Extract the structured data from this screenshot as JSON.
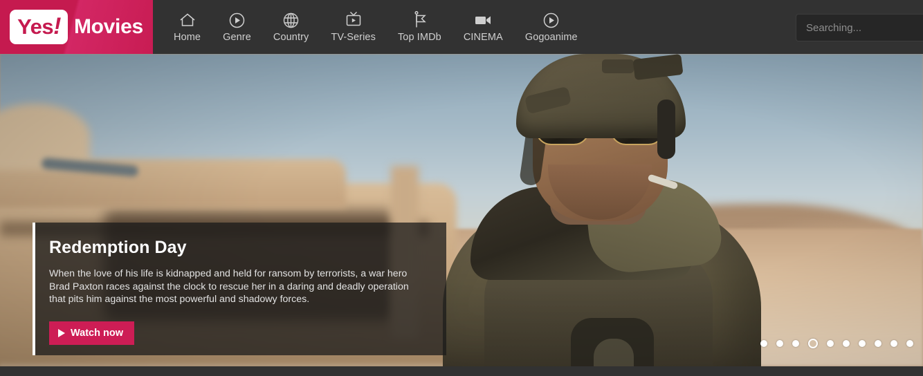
{
  "site": {
    "logo_yes": "Yes",
    "logo_bang": "!",
    "logo_movies": "Movies",
    "brand_color": "#c51a4f",
    "header_bg": "#323232"
  },
  "nav": {
    "items": [
      {
        "label": "Home",
        "icon": "home-icon"
      },
      {
        "label": "Genre",
        "icon": "play-circle-icon"
      },
      {
        "label": "Country",
        "icon": "globe-icon"
      },
      {
        "label": "TV-Series",
        "icon": "tv-play-icon"
      },
      {
        "label": "Top IMDb",
        "icon": "flag-icon"
      },
      {
        "label": "CINEMA",
        "icon": "video-camera-icon"
      },
      {
        "label": "Gogoanime",
        "icon": "play-circle-icon"
      }
    ]
  },
  "search": {
    "placeholder": "Searching...",
    "value": "",
    "icon": "search-icon"
  },
  "hero": {
    "title": "Redemption Day",
    "description": "When the love of his life is kidnapped and held for ransom by terrorists, a war hero Brad Paxton races against the clock to rescue her in a daring and deadly operation that pits him against the most powerful and shadowy forces.",
    "watch_label": "Watch now",
    "watch_icon": "play-icon",
    "button_color": "#cd1d55",
    "image_alt": "Soldier in helmet and aviator sunglasses standing beside an armored desert vehicle"
  },
  "carousel": {
    "total_slides": 10,
    "active_index": 4,
    "slides": [
      "1",
      "2",
      "3",
      "4",
      "5",
      "6",
      "7",
      "8",
      "9",
      "10"
    ]
  }
}
